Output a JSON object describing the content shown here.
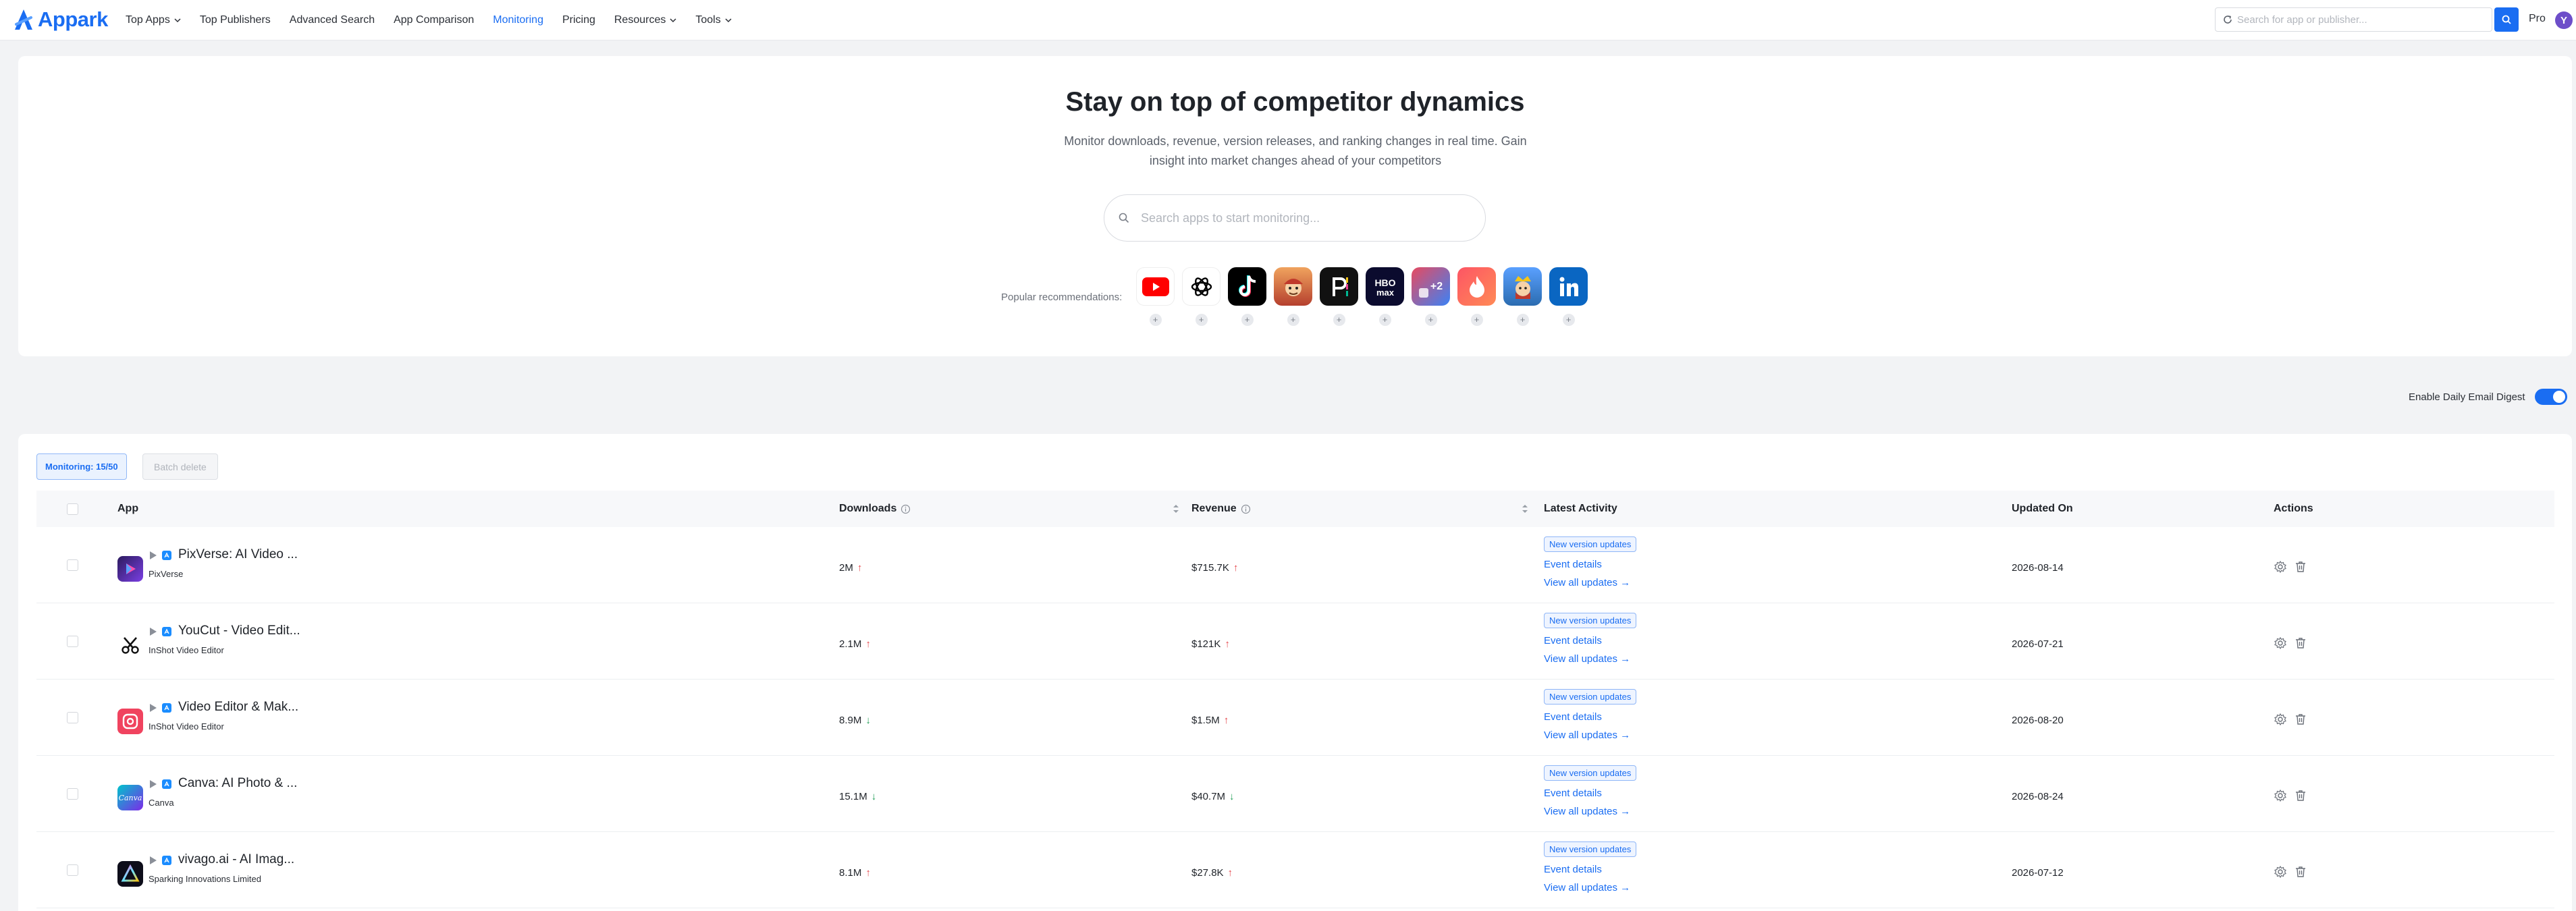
{
  "brand": {
    "name": "Appark",
    "color": "#1a6df2"
  },
  "nav": {
    "items": [
      {
        "label": "Top Apps",
        "dropdown": true,
        "active": false
      },
      {
        "label": "Top Publishers",
        "dropdown": false,
        "active": false
      },
      {
        "label": "Advanced Search",
        "dropdown": false,
        "active": false
      },
      {
        "label": "App Comparison",
        "dropdown": false,
        "active": false
      },
      {
        "label": "Monitoring",
        "dropdown": false,
        "active": true
      },
      {
        "label": "Pricing",
        "dropdown": false,
        "active": false
      },
      {
        "label": "Resources",
        "dropdown": true,
        "active": false
      },
      {
        "label": "Tools",
        "dropdown": true,
        "active": false
      }
    ],
    "search_placeholder": "Search for app or publisher...",
    "plan": "Pro",
    "avatar_letter": "Y"
  },
  "hero": {
    "title": "Stay on top of competitor dynamics",
    "subtitle": "Monitor downloads, revenue, version releases, and ranking changes in real time. Gain insight into market changes ahead of your competitors",
    "search_placeholder": "Search apps to start monitoring...",
    "recommendations_label": "Popular recommendations:",
    "recommendations": [
      {
        "icon": "youtube-icon",
        "color": "#ff0000"
      },
      {
        "icon": "chatgpt-icon",
        "color": "#000000"
      },
      {
        "icon": "tiktok-icon",
        "color": "#000000"
      },
      {
        "icon": "game-character-icon",
        "color": "#c0392b"
      },
      {
        "icon": "picsart-icon",
        "color": "#111111"
      },
      {
        "icon": "hbo-max-icon",
        "color": "#0b0b2e"
      },
      {
        "icon": "game-plus2-icon",
        "color": "#3b82f6"
      },
      {
        "icon": "tinder-icon",
        "color": "#fe3c72"
      },
      {
        "icon": "clash-royale-icon",
        "color": "#2b6cb0"
      },
      {
        "icon": "linkedin-icon",
        "color": "#0a66c2"
      }
    ],
    "add_symbol": "+"
  },
  "digest": {
    "label": "Enable Daily Email Digest",
    "enabled": true
  },
  "table": {
    "monitoring_badge": "Monitoring: 15/50",
    "batch_delete": "Batch delete",
    "headers": {
      "app": "App",
      "downloads": "Downloads",
      "revenue": "Revenue",
      "latest_activity": "Latest Activity",
      "updated_on": "Updated On",
      "actions": "Actions"
    },
    "activity_tag": "New version updates",
    "event_details": "Event details",
    "view_all": "View all updates →",
    "rows": [
      {
        "name": "PixVerse: AI Video ...",
        "publisher": "PixVerse",
        "downloads": "2M",
        "downloads_trend": "up",
        "revenue": "$715.7K",
        "revenue_trend": "up",
        "updated": "2026-08-14",
        "icon": "pixverse-icon"
      },
      {
        "name": "YouCut - Video Edit...",
        "publisher": "InShot Video Editor",
        "downloads": "2.1M",
        "downloads_trend": "up",
        "revenue": "$121K",
        "revenue_trend": "up",
        "updated": "2026-07-21",
        "icon": "scissors-icon"
      },
      {
        "name": "Video Editor & Mak...",
        "publisher": "InShot Video Editor",
        "downloads": "8.9M",
        "downloads_trend": "down",
        "revenue": "$1.5M",
        "revenue_trend": "up",
        "updated": "2026-08-20",
        "icon": "inshot-icon"
      },
      {
        "name": "Canva: AI Photo & ...",
        "publisher": "Canva",
        "downloads": "15.1M",
        "downloads_trend": "down",
        "revenue": "$40.7M",
        "revenue_trend": "down",
        "updated": "2026-08-24",
        "icon": "canva-icon"
      },
      {
        "name": "vivago.ai - AI Imag...",
        "publisher": "Sparking Innovations Limited",
        "downloads": "8.1M",
        "downloads_trend": "up",
        "revenue": "$27.8K",
        "revenue_trend": "up",
        "updated": "2026-07-12",
        "icon": "vivago-icon"
      }
    ],
    "arrows": {
      "up": "↑",
      "down": "↓"
    }
  }
}
